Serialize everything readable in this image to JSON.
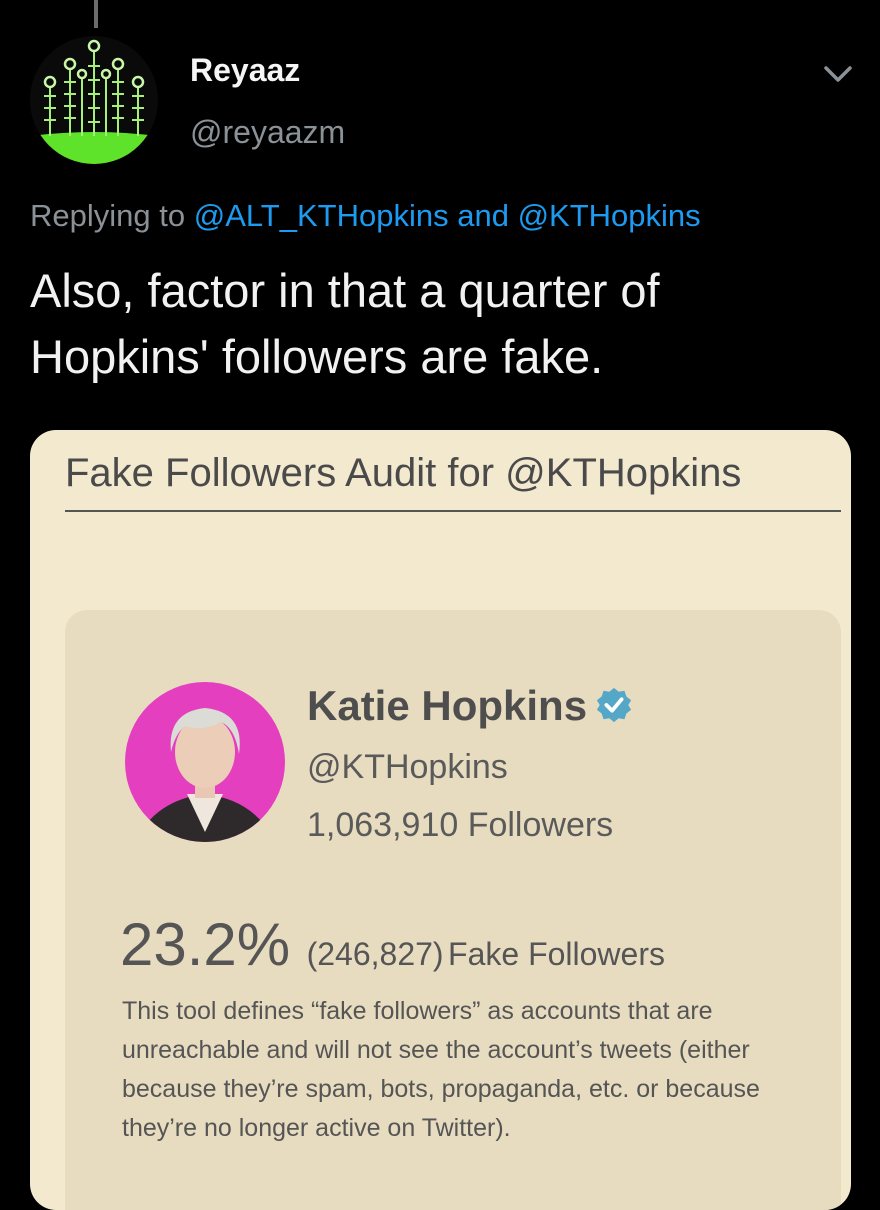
{
  "tweet": {
    "author_name": "Reyaaz",
    "author_handle": "@reyaazm",
    "replying_prefix": "Replying to",
    "reply_mention_1": "@ALT_KTHopkins",
    "reply_conjunction": "and",
    "reply_mention_2": "@KTHopkins",
    "text": "Also, factor in that a quarter of Hopkins' followers are fake."
  },
  "audit_card": {
    "title": "Fake Followers Audit for @KTHopkins",
    "profile_name": "Katie Hopkins",
    "profile_handle": "@KTHopkins",
    "followers_text": "1,063,910 Followers",
    "fake_percent": "23.2%",
    "fake_count": "(246,827)",
    "fake_label": "Fake Followers",
    "definition": "This tool defines “fake followers” as accounts that are unreachable and will not see the account’s tweets (either because they’re spam, bots, propaganda, etc. or because they’re no longer active on Twitter)."
  },
  "icons": {
    "avatar": "circuit-tree-avatar",
    "chevron": "chevron-down-icon",
    "verified": "verified-badge-icon"
  },
  "colors": {
    "background": "#000000",
    "mention": "#1d9bf0",
    "card_background": "#f2e9cf",
    "inner_card_background": "#e8dcc0",
    "profile_ring": "#e43fbf",
    "verified_badge": "#55a7c8"
  }
}
